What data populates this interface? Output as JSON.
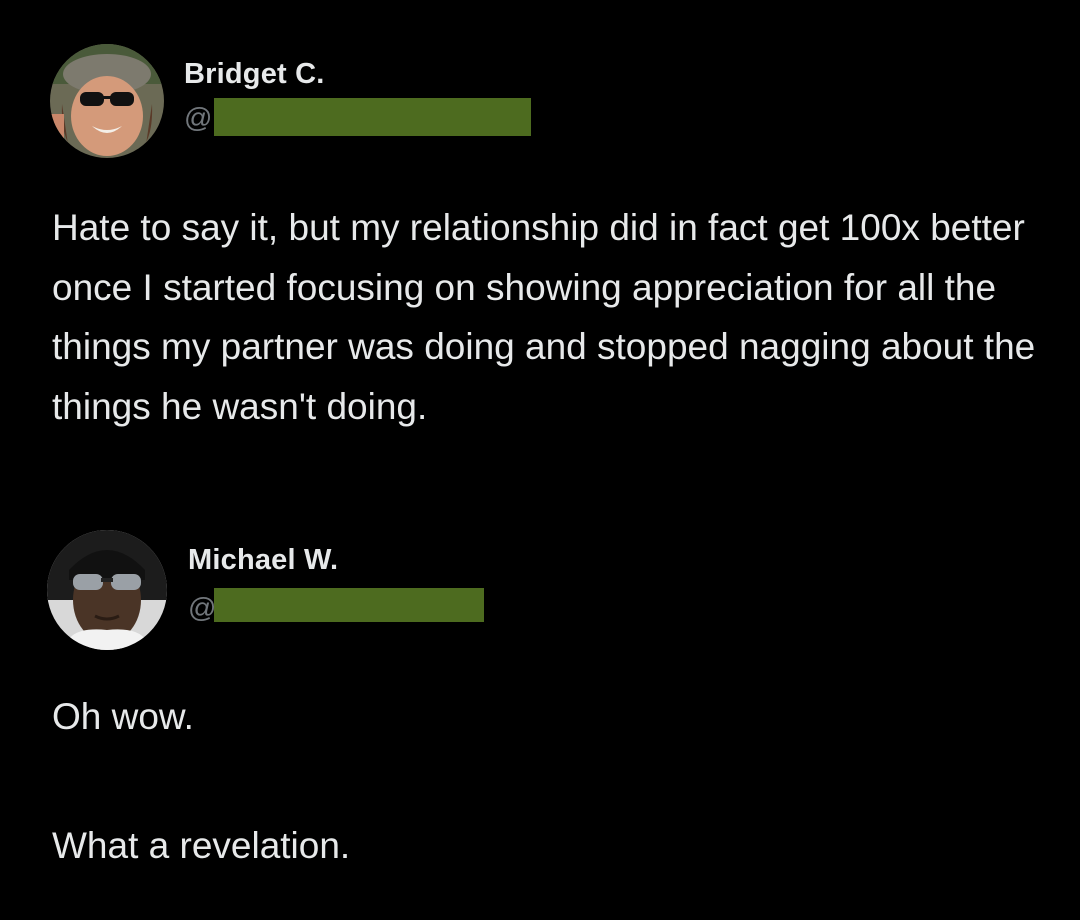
{
  "tweets": [
    {
      "author": {
        "display_name": "Bridget C.",
        "handle_prefix": "@",
        "avatar_icon": "user-avatar-photo"
      },
      "text": "Hate to say it, but my relationship did in fact get 100x better once I started focusing on showing appreciation for all the things my partner was doing and stopped nagging about the things he wasn't doing."
    },
    {
      "author": {
        "display_name": "Michael W.",
        "handle_prefix": "@",
        "avatar_icon": "user-avatar-photo"
      },
      "paragraphs": [
        "Oh wow.",
        "What a revelation."
      ]
    }
  ],
  "colors": {
    "background": "#000000",
    "text_primary": "#e7e9ea",
    "text_secondary": "#71767b",
    "redaction": "#4d6b1f"
  }
}
